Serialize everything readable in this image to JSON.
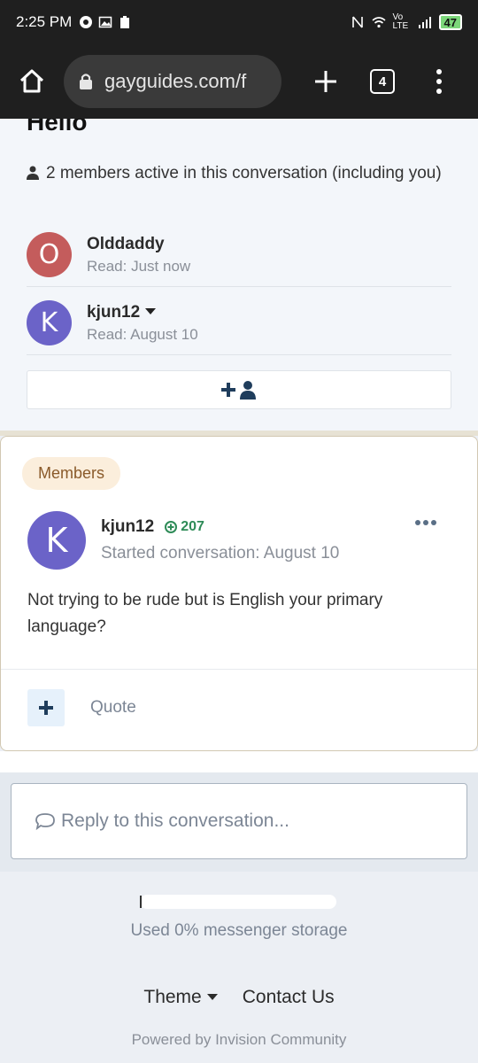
{
  "status_bar": {
    "time": "2:25 PM",
    "network": "Vo LTE",
    "battery": "47"
  },
  "browser": {
    "url": "gayguides.com/f",
    "tab_count": "4"
  },
  "conversation": {
    "title": "Hello",
    "active_text": "2 members active in this conversation (including you)",
    "participants": [
      {
        "initial": "O",
        "name": "Olddaddy",
        "read": "Read: Just now",
        "color": "#c45c5c"
      },
      {
        "initial": "K",
        "name": "kjun12",
        "read": "Read: August 10",
        "color": "#6b63c8"
      }
    ]
  },
  "post": {
    "badge": "Members",
    "author_initial": "K",
    "author": "kjun12",
    "reputation": "207",
    "started": "Started conversation: August 10",
    "body": "Not trying to be rude but is English your primary language?",
    "quote_label": "Quote"
  },
  "reply": {
    "placeholder": "Reply to this conversation..."
  },
  "footer": {
    "storage_percent": 0,
    "storage_text": "Used 0% messenger storage",
    "theme_label": "Theme",
    "contact_label": "Contact Us",
    "powered_by": "Powered by Invision Community"
  }
}
